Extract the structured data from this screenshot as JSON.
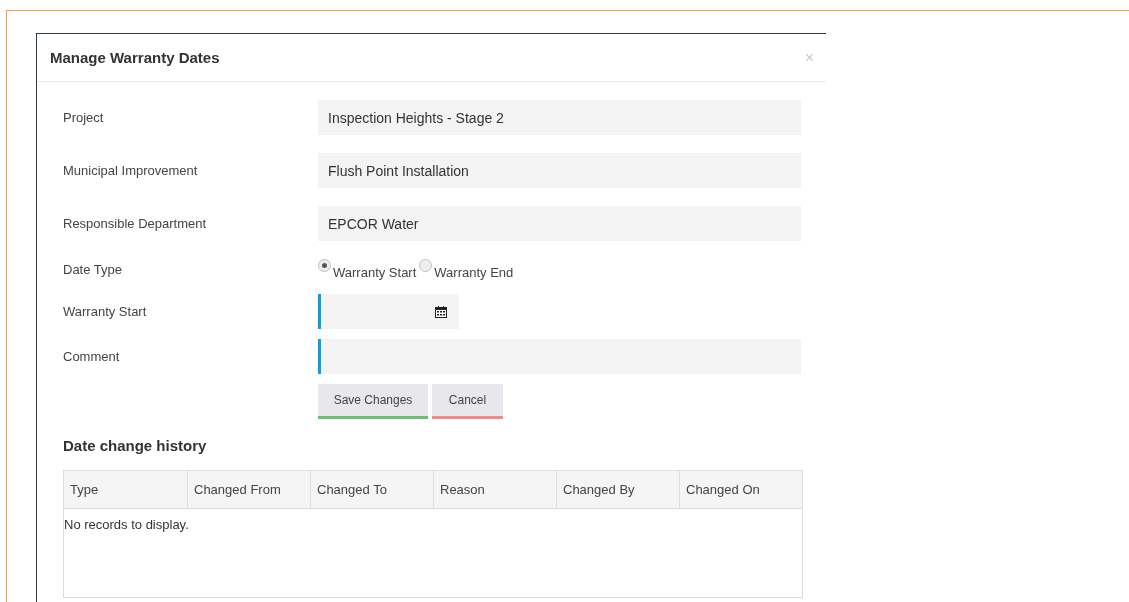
{
  "dialog": {
    "title": "Manage Warranty Dates",
    "close": "×"
  },
  "fields": [
    {
      "kind": "readonly",
      "label": "Project",
      "value": "Inspection Heights - Stage 2"
    },
    {
      "kind": "readonly",
      "label": "Municipal Improvement",
      "value": "Flush Point Installation"
    },
    {
      "kind": "readonly",
      "label": "Responsible Department",
      "value": "EPCOR Water"
    },
    {
      "kind": "radio",
      "label": "Date Type",
      "options": [
        {
          "label": "Warranty Start",
          "selected": true
        },
        {
          "label": "Warranty End",
          "selected": false
        }
      ]
    },
    {
      "kind": "date",
      "label": "Warranty Start"
    },
    {
      "kind": "text",
      "label": "Comment"
    }
  ],
  "buttons": [
    {
      "label": "Save Changes",
      "kind": "save"
    },
    {
      "label": "Cancel",
      "kind": "cancel"
    }
  ],
  "history": {
    "title": "Date change history",
    "columns": [
      "Type",
      "Changed From",
      "Changed To",
      "Reason",
      "Changed By",
      "Changed On"
    ],
    "empty_message": "No records to display."
  }
}
